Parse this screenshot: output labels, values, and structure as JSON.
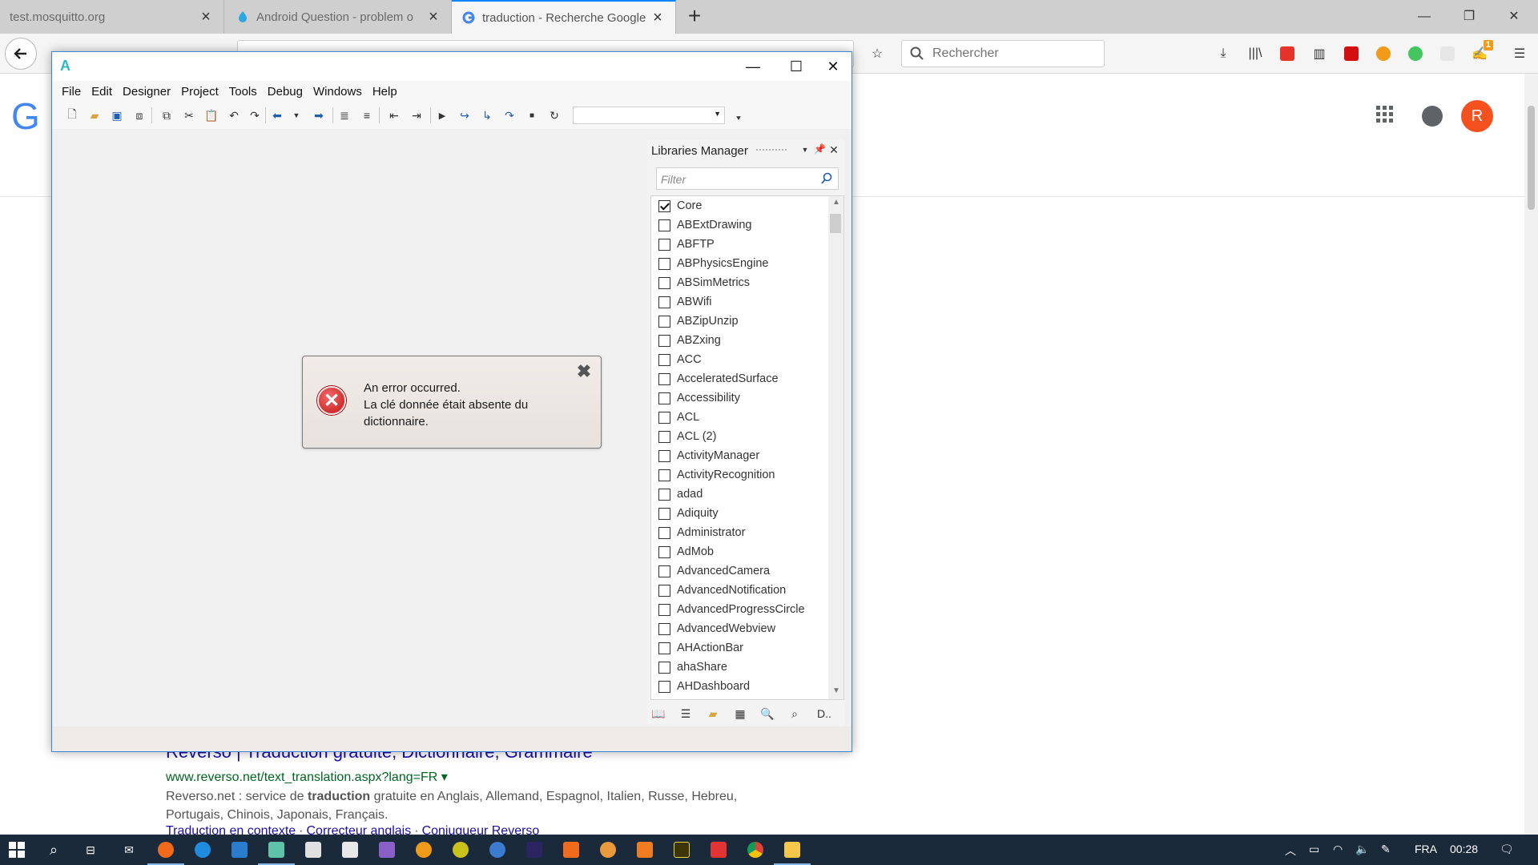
{
  "browser": {
    "tabs": [
      {
        "title": "test.mosquitto.org",
        "active": false
      },
      {
        "title": "Android Question - problem o",
        "active": false
      },
      {
        "title": "traduction - Recherche Google",
        "active": true
      }
    ],
    "search_placeholder": "Rechercher",
    "extension_badge": "1"
  },
  "google": {
    "logo_partial": "G",
    "avatar_letter": "R",
    "result": {
      "title": "Reverso | Traduction gratuite, Dictionnaire, Grammaire",
      "url": "www.reverso.net/text_translation.aspx?lang=FR",
      "snippet_before": "Reverso.net : service de ",
      "snippet_bold": "traduction",
      "snippet_after": " gratuite en Anglais, Allemand, Espagnol, Italien, Russe, Hebreu, Portugais, Chinois, Japonais, Français.",
      "links": [
        "Traduction en contexte",
        "Correcteur anglais",
        "Conjugueur Reverso"
      ]
    }
  },
  "ide": {
    "logo": "A",
    "menu": [
      "File",
      "Edit",
      "Designer",
      "Project",
      "Tools",
      "Debug",
      "Windows",
      "Help"
    ],
    "libraries": {
      "title": "Libraries Manager",
      "filter_placeholder": "Filter",
      "items": [
        {
          "name": "Core",
          "checked": true
        },
        {
          "name": "ABExtDrawing",
          "checked": false
        },
        {
          "name": "ABFTP",
          "checked": false
        },
        {
          "name": "ABPhysicsEngine",
          "checked": false
        },
        {
          "name": "ABSimMetrics",
          "checked": false
        },
        {
          "name": "ABWifi",
          "checked": false
        },
        {
          "name": "ABZipUnzip",
          "checked": false
        },
        {
          "name": "ABZxing",
          "checked": false
        },
        {
          "name": "ACC",
          "checked": false
        },
        {
          "name": "AcceleratedSurface",
          "checked": false
        },
        {
          "name": "Accessibility",
          "checked": false
        },
        {
          "name": "ACL",
          "checked": false
        },
        {
          "name": "ACL (2)",
          "checked": false
        },
        {
          "name": "ActivityManager",
          "checked": false
        },
        {
          "name": "ActivityRecognition",
          "checked": false
        },
        {
          "name": "adad",
          "checked": false
        },
        {
          "name": "Adiquity",
          "checked": false
        },
        {
          "name": "Administrator",
          "checked": false
        },
        {
          "name": "AdMob",
          "checked": false
        },
        {
          "name": "AdvancedCamera",
          "checked": false
        },
        {
          "name": "AdvancedNotification",
          "checked": false
        },
        {
          "name": "AdvancedProgressCircle",
          "checked": false
        },
        {
          "name": "AdvancedWebview",
          "checked": false
        },
        {
          "name": "AHActionBar",
          "checked": false
        },
        {
          "name": "ahaShare",
          "checked": false
        },
        {
          "name": "AHDashboard",
          "checked": false
        }
      ],
      "last_tab_label": "D.."
    },
    "error": {
      "line1": "An error occurred.",
      "line2": "La clé donnée était absente du dictionnaire."
    }
  },
  "taskbar": {
    "language": "FRA",
    "time": "00:28"
  }
}
